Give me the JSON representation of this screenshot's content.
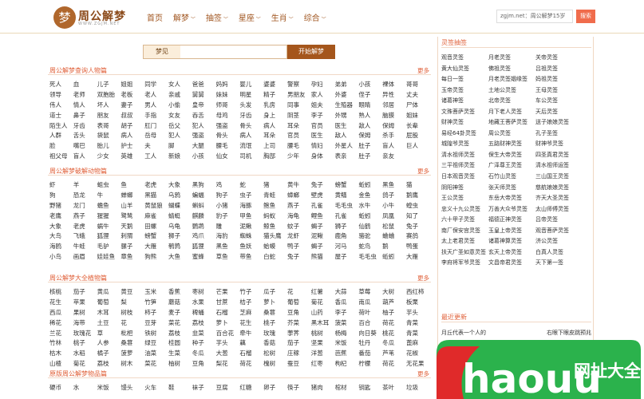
{
  "header": {
    "logo_char": "梦",
    "logo_title": "周公解梦",
    "logo_sub": "WWW.ZGJM.NET",
    "nav": [
      "首页",
      "解梦",
      "抽签",
      "星座",
      "生肖",
      "综合"
    ],
    "nav_dropdown": [
      false,
      true,
      true,
      true,
      true,
      true
    ],
    "search_value": "zgjm.net：周公解梦15岁",
    "search_button": "搜索"
  },
  "search": {
    "label": "梦见",
    "placeholder": "",
    "button": "开始解梦"
  },
  "sections": [
    {
      "title": "周公解梦查询人物篇",
      "more": "更多",
      "items": [
        "死人",
        "血",
        "儿子",
        "姐姐",
        "同学",
        "女人",
        "爸爸",
        "妈妈",
        "婴儿",
        "婆婆",
        "警察",
        "孕妇",
        "弟弟",
        "小孩",
        "裸体",
        "哥哥",
        "领导",
        "老师",
        "双胞胎",
        "老板",
        "老人",
        "亲戚",
        "舅舅",
        "妹妹",
        "明星",
        "精子",
        "男朋友",
        "家人",
        "外婆",
        "侄子",
        "异性",
        "丈夫",
        "伟人",
        "情人",
        "坏人",
        "妻子",
        "男人",
        "小偷",
        "皇帝",
        "师哥",
        "头发",
        "乳房",
        "同事",
        "姐夫",
        "生殖器",
        "眼睛",
        "邻居",
        "尸体",
        "道士",
        "鼻子",
        "朋友",
        "叔叔",
        "手指",
        "女友",
        "吞舌",
        "母鸡",
        "牙齿",
        "身上",
        "阴茎",
        "李子",
        "外甥",
        "熟人",
        "脑膜",
        "姐妹",
        "陌生人",
        "牙齿",
        "表哥",
        "胡子",
        "肛门",
        "岳父",
        "犯人",
        "强盗",
        "骨头",
        "病人",
        "耳朵",
        "官员",
        "医生",
        "敌人",
        "保姆",
        "长辈",
        "人群",
        "舌头",
        "袋鼠",
        "病人",
        "岳母",
        "犯人",
        "强盗",
        "骨头",
        "病人",
        "耳朵",
        "官员",
        "医生",
        "敌人",
        "保姆",
        "杀手",
        "屁股",
        "脸",
        "嘴巴",
        "胎儿",
        "护士",
        "夫",
        "脚",
        "大腿",
        "腰毛",
        "流氓",
        "上司",
        "腰毛",
        "情妇",
        "外星人",
        "肚子",
        "盲人",
        "巨人",
        "祖父母",
        "盲人",
        "少女",
        "英雄",
        "工人",
        "新娘",
        "小孩",
        "仙女",
        "司机",
        "胸部",
        "少年",
        "身体",
        "表亲",
        "肚子",
        "亲友"
      ]
    },
    {
      "title": "周公解梦破解动物篇",
      "more": "更多",
      "items": [
        "虾",
        "羊",
        "蛆虫",
        "鱼",
        "老虎",
        "大象",
        "黑狗",
        "鸡",
        "蛇",
        "猪",
        "黄牛",
        "兔子",
        "螃蟹",
        "蚯蚓",
        "黑鱼",
        "猫",
        "狗",
        "恐龙",
        "牛",
        "蝉螂",
        "黑猫",
        "乌鸦",
        "蝙蝠",
        "狗子",
        "虫子",
        "青蛙",
        "蟑螂",
        "壁虎",
        "黄鳝",
        "金鱼",
        "鸽子",
        "鹅鹰",
        "野猪",
        "龙门",
        "蟾鱼",
        "山羊",
        "黄鼠狼",
        "蝴蝶",
        "蝌蚪",
        "小猪",
        "海豚",
        "鲍鱼",
        "燕子",
        "孔雀",
        "毛毛虫",
        "水牛",
        "小牛",
        "蝗虫",
        "老鹰",
        "燕子",
        "猩猩",
        "鹭鸶",
        "麻雀",
        "蜻蜓",
        "麒麟",
        "豹子",
        "甲鱼",
        "蚂蚁",
        "海龟",
        "鲤鱼",
        "孔雀",
        "蚯蚓",
        "凤凰",
        "知了",
        "大象",
        "老虎",
        "蜗牛",
        "天鹅",
        "田螺",
        "乌龟",
        "鹦鹉",
        "雕",
        "泥鳅",
        "鲸鱼",
        "蚊子",
        "蝎子",
        "狮子",
        "仙鹤",
        "松鼠",
        "兔子",
        "大鸟",
        "飞蛾",
        "狐狸",
        "刺猬",
        "螃蟹",
        "狮子",
        "鸡爪",
        "海豹",
        "蜘蛛",
        "猫头鹰",
        "龙虾",
        "泥鳅",
        "鹿角",
        "骆驼",
        "蛐蛐",
        "赛鸽",
        "海鸥",
        "牛蛙",
        "毛驴",
        "骡子",
        "大雁",
        "鹌鹑",
        "狐狸",
        "黑鱼",
        "鱼妖",
        "蛤蟆",
        "鸭子",
        "蝎子",
        "河马",
        "蛇鸟",
        "鹅",
        "鸭蛋",
        "小鸟",
        "画眉",
        "娃娃鱼",
        "章鱼",
        "狗熊",
        "大鱼",
        "蜜蜂",
        "草鱼",
        "带鱼",
        "白蛇",
        "兔子",
        "熊猫",
        "屋子",
        "毛毛虫",
        "蚯蚓",
        "大雁"
      ]
    },
    {
      "title": "周公解梦大全植物篇",
      "more": "更多",
      "items": [
        "核桃",
        "茄子",
        "黄瓜",
        "黄豆",
        "玉米",
        "香蕉",
        "枣树",
        "芒果",
        "竹子",
        "瓜子",
        "花",
        "红薯",
        "大蒜",
        "草莓",
        "大树",
        "西红柿",
        "花生",
        "苹果",
        "葡萄",
        "梨",
        "竹笋",
        "蘑菇",
        "水果",
        "甘蔗",
        "桔子",
        "萝卜",
        "葡萄",
        "菊花",
        "香瓜",
        "南瓜",
        "葫芦",
        "板栗",
        "西瓜",
        "果树",
        "木耳",
        "树枝",
        "柿子",
        "麦子",
        "稗蛹",
        "石榴",
        "芝麻",
        "桑葚",
        "豆角",
        "山药",
        "李子",
        "荷叶",
        "柚子",
        "芋头",
        "稀花",
        "海带",
        "土豆",
        "花",
        "豆芽",
        "菜花",
        "荔枝",
        "萝卜",
        "花生",
        "桃子",
        "芥菜",
        "黑木耳",
        "菠菜",
        "百合",
        "荷花",
        "青菜",
        "兰花",
        "玫瑰花",
        "草",
        "枇杷",
        "铁树",
        "荔枝",
        "韭菜",
        "百合花",
        "牵牛",
        "玫瑰",
        "荸荠",
        "桃树",
        "杨梅",
        "向日葵",
        "桃花",
        "青菜",
        "竹林",
        "桃子",
        "人参",
        "桑葚",
        "绿豆",
        "桂圆",
        "种子",
        "芋头",
        "藕",
        "香菇",
        "茄子",
        "坚果",
        "米饭",
        "牡丹",
        "冬瓜",
        "蓖麻",
        "枯木",
        "水稻",
        "橘子",
        "菠萝",
        "油菜",
        "生菜",
        "冬瓜",
        "大葱",
        "石榴",
        "松树",
        "庄稼",
        "洋葱",
        "芭蕉",
        "番茄",
        "芦苇",
        "花椒",
        "山楂",
        "菊花",
        "荔枝",
        "树木",
        "菜花",
        "柚树",
        "豆角",
        "梨花",
        "荷花",
        "槐树",
        "蚕豆",
        "红枣",
        "枸杞",
        "柠檬",
        "荷花",
        "无花果"
      ]
    },
    {
      "title": "原版周公解梦物品篇",
      "more": "更多",
      "items": [
        "硬币",
        "水",
        "米饭",
        "馒头",
        "火车",
        "鞋",
        "袜子",
        "豆腐",
        "红糖",
        "卵子",
        "筷子",
        "猪肉",
        "棺材",
        "钥匙",
        "茶叶",
        "垃圾"
      ]
    }
  ],
  "sidebar": {
    "lingqian_title": "灵签抽签",
    "lingqian": [
      "观音灵签",
      "月老灵签",
      "关帝灵签",
      "黄大仙灵签",
      "佛祖灵签",
      "吕祖灵签",
      "每日一签",
      "月老灵签姻缘签",
      "妈祖灵签",
      "玉帝灵签",
      "土地公灵签",
      "王母灵签",
      "诸葛神签",
      "北帝灵签",
      "车公灵签",
      "文殊菩萨灵签",
      "月下老人灵签",
      "天后灵签",
      "财神灵签",
      "地藏王菩萨灵签",
      "送子娘娘灵签",
      "易经64卦灵签",
      "周公灵签",
      "孔子圣签",
      "城隍爷灵签",
      "五路财神灵签",
      "财神爷灵签",
      "清水祖师灵签",
      "保生大帝灵签",
      "四圣真君灵签",
      "三平祖师灵签",
      "广泽尊王灵签",
      "清水祖师运签",
      "日本观音灵签",
      "石竹山灵签",
      "三山国王灵签",
      "阴阳神签",
      "张天师灵签",
      "慈航娘娘灵签",
      "王公灵签",
      "东岳大帝灵签",
      "齐天大圣灵签",
      "忠义十九公灵签",
      "万善大众爷灵签",
      "太山师傅灵签",
      "六十甲子灵签",
      "福德正神灵签",
      "吕帝灵签",
      "南厂保安宫灵签",
      "玉皇上帝灵签",
      "观音菩萨灵签",
      "太上老君灵签",
      "诸葛神算灵签",
      "济公灵签",
      "扶天广圣如意灵签",
      "玄天上帝灵签",
      "白真人灵签",
      "李府将军爷灵签",
      "文昌帝君灵签",
      "天下第一签"
    ],
    "news_title": "最近更新",
    "news": [
      {
        "left": "月丘代表一个人的",
        "right": "右眼下眼皮跳预兆"
      }
    ]
  },
  "watermark": {
    "brand": "haouu.com",
    "text": "网址大全"
  }
}
